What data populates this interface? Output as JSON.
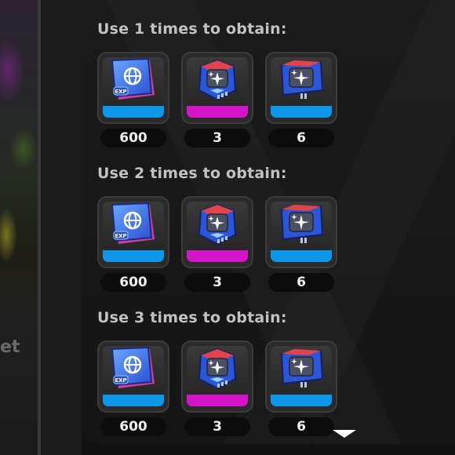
{
  "background": {
    "left_text": "et"
  },
  "colors": {
    "stripe_blue": "#0e96e8",
    "stripe_magenta": "#d414c8",
    "title_text": "#c2c2c2",
    "count_text": "#f0f0f0"
  },
  "sections": [
    {
      "title": "Use 1 times to obtain:",
      "items": [
        {
          "icon": "exp-book-icon",
          "count": "600",
          "stripe": "blue"
        },
        {
          "icon": "blue-red-chip-icon",
          "count": "3",
          "stripe": "magenta"
        },
        {
          "icon": "red-blue-chip-icon",
          "count": "6",
          "stripe": "blue"
        }
      ]
    },
    {
      "title": "Use 2 times to obtain:",
      "items": [
        {
          "icon": "exp-book-icon",
          "count": "600",
          "stripe": "blue"
        },
        {
          "icon": "blue-red-chip-icon",
          "count": "3",
          "stripe": "magenta"
        },
        {
          "icon": "red-blue-chip-icon",
          "count": "6",
          "stripe": "blue"
        }
      ]
    },
    {
      "title": "Use 3 times to obtain:",
      "items": [
        {
          "icon": "exp-book-icon",
          "count": "600",
          "stripe": "blue"
        },
        {
          "icon": "blue-red-chip-icon",
          "count": "3",
          "stripe": "magenta"
        },
        {
          "icon": "red-blue-chip-icon",
          "count": "6",
          "stripe": "blue"
        }
      ]
    }
  ],
  "scroll_indicator": "chevron-down-icon"
}
